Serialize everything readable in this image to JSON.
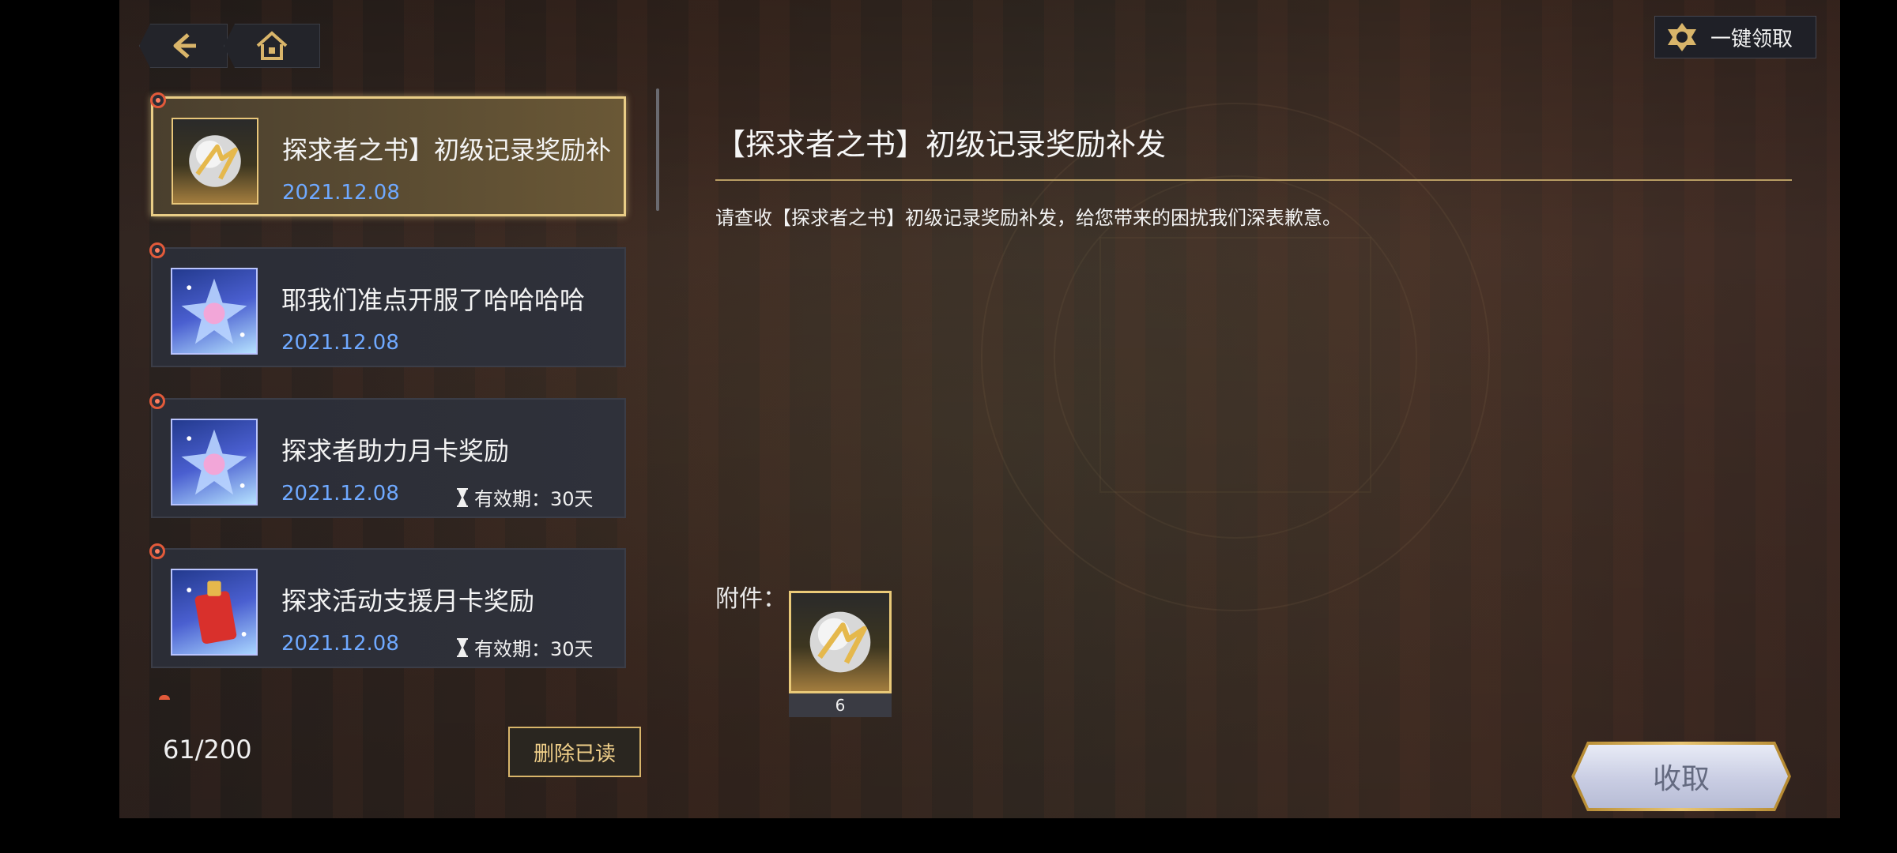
{
  "header": {
    "back_icon": "back-arrow-icon",
    "home_icon": "home-icon",
    "claim_all_label": "一键领取",
    "claim_all_icon": "emblem-icon"
  },
  "mail_list": {
    "items": [
      {
        "title": "探求者之书】初级记录奖励补",
        "date": "2021.12.08",
        "thumbnail": "golden-orb-icon",
        "selected": true,
        "unread": true,
        "validity": ""
      },
      {
        "title": "耶我们准点开服了哈哈哈哈",
        "date": "2021.12.08",
        "thumbnail": "star-crystal-icon",
        "selected": false,
        "unread": true,
        "validity": ""
      },
      {
        "title": "探求者助力月卡奖励",
        "date": "2021.12.08",
        "thumbnail": "star-crystal-icon",
        "selected": false,
        "unread": true,
        "validity": "有效期：30天"
      },
      {
        "title": "探求活动支援月卡奖励",
        "date": "2021.12.08",
        "thumbnail": "red-gift-box-icon",
        "selected": false,
        "unread": true,
        "validity": "有效期：30天"
      }
    ],
    "count": "61/200",
    "delete_read_label": "删除已读"
  },
  "detail": {
    "title": "【探求者之书】初级记录奖励补发",
    "body": "请查收【探求者之书】初级记录奖励补发，给您带来的困扰我们深表歉意。",
    "attachment_label": "附件：",
    "attachments": [
      {
        "icon": "golden-orb-icon",
        "quantity": "6"
      }
    ],
    "claim_label": "收取"
  },
  "colors": {
    "accent_gold": "#e9cd86",
    "date_blue": "#6fa9ff",
    "unread_red": "#e25a3a"
  }
}
